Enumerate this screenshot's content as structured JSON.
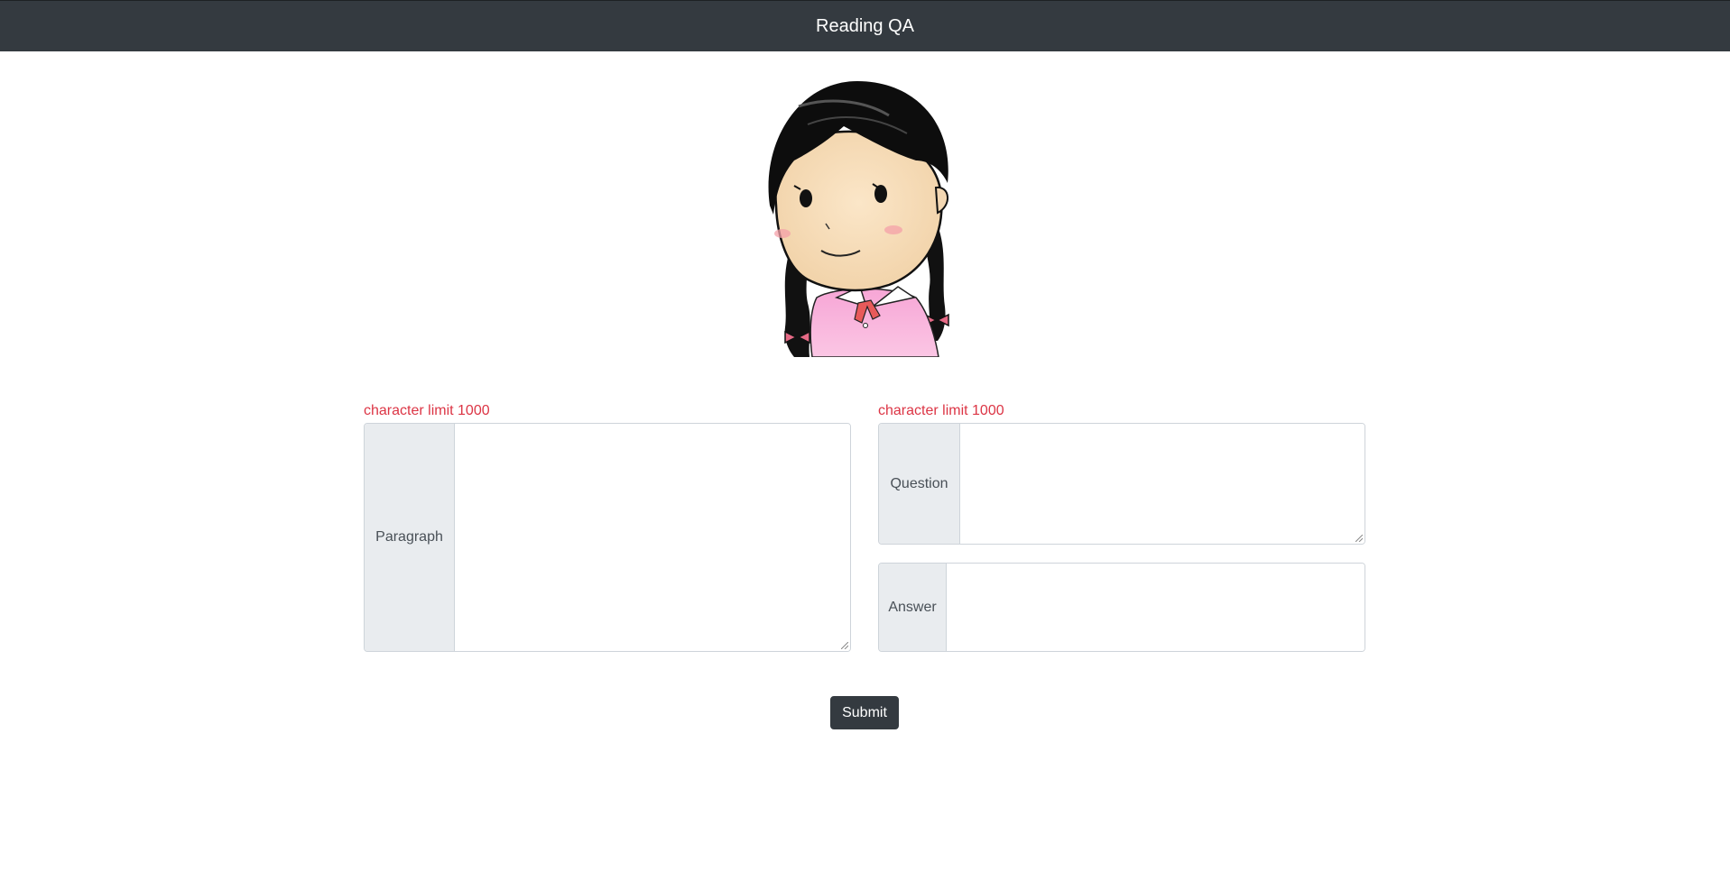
{
  "app": {
    "title": "Reading QA"
  },
  "hero": {
    "image": "girl-with-braids-illustration"
  },
  "paragraph": {
    "limit_note": "character limit 1000",
    "label": "Paragraph",
    "value": ""
  },
  "question": {
    "limit_note": "character limit 1000",
    "label": "Question",
    "value": ""
  },
  "answer": {
    "label": "Answer",
    "value": ""
  },
  "actions": {
    "submit_label": "Submit"
  },
  "colors": {
    "navbar": "#343a40",
    "limit_text": "#dc3545",
    "addon_bg": "#e9ecef",
    "border": "#ced4da"
  }
}
